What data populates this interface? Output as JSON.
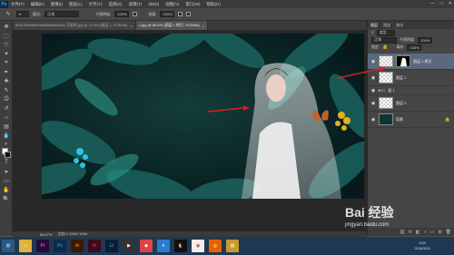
{
  "menu": {
    "app": "Ps",
    "items": [
      "文件(F)",
      "编辑(E)",
      "图像(I)",
      "图层(L)",
      "文字(Y)",
      "选择(S)",
      "滤镜(T)",
      "3D(D)",
      "视图(V)",
      "窗口(W)",
      "帮助(H)"
    ],
    "window_controls": [
      "—",
      "□",
      "✕"
    ]
  },
  "options": {
    "mode_label": "模式:",
    "mode_value": "正常",
    "opacity_label": "不透明度:",
    "opacity_value": "100%",
    "flow_label": "流量:",
    "flow_value": "100%"
  },
  "tabs": [
    {
      "label": "8b8795ab5ebf4d6a5a5d6b0da-可爱的.jpg @ 12.5% (图层 1, RGB/8#)",
      "active": false
    },
    {
      "label": "1.jpg @ 66.6% (图层 1 拷贝, RGB/8#)",
      "active": true
    }
  ],
  "status": {
    "zoom": "66.67%",
    "doc": "文档:1.22M/7.69M"
  },
  "panel": {
    "tabs": [
      "图层",
      "通道",
      "路径"
    ],
    "filter_label": "类型",
    "blend_value": "正常",
    "opacity_label": "不透明度:",
    "opacity_value": "100%",
    "lock_label": "锁定:",
    "fill_label": "填充:",
    "fill_value": "100%",
    "layers": [
      {
        "name": "图层 1 拷贝",
        "selected": true
      },
      {
        "name": "图层 1",
        "selected": false
      },
      {
        "name": "组 1",
        "selected": false,
        "group": true
      },
      {
        "name": "图层 0",
        "selected": false
      },
      {
        "name": "背景",
        "selected": false
      }
    ]
  },
  "taskbar": {
    "apps": [
      "Pr",
      "Ps",
      "Ai",
      "Id",
      "Lr"
    ],
    "time": "6:02",
    "date": "2018/5/11"
  },
  "watermark": {
    "brand": "Bai 经验",
    "url": "jingyan.baidu.com"
  },
  "colors": {
    "canvas_bg": "#0c2a2c",
    "leaf": "#1b6b68",
    "arrow": "#d42020",
    "selection": "#5a6a7c"
  }
}
